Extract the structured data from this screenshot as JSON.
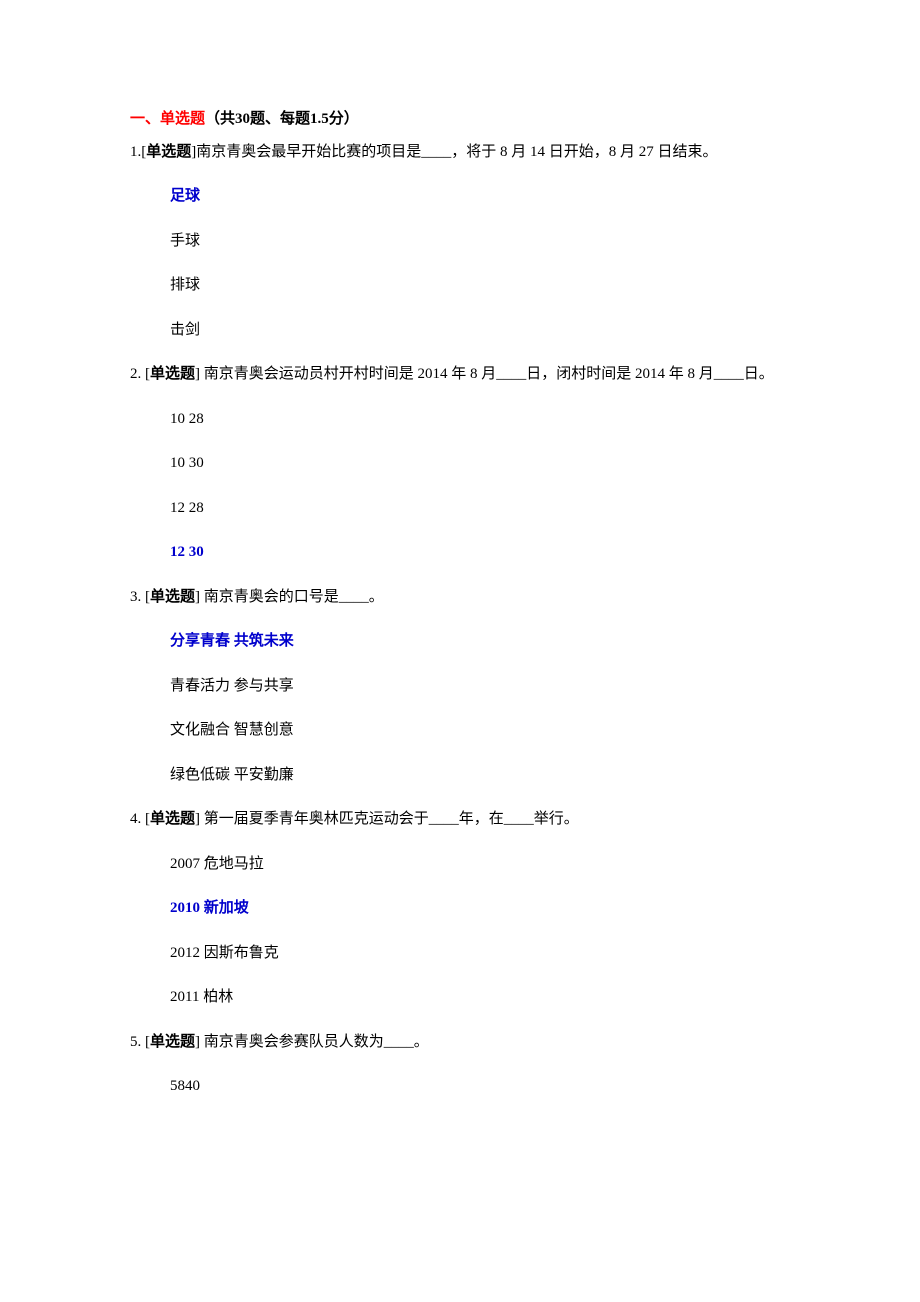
{
  "section": {
    "number": "一、",
    "title": "单选题",
    "count": "（共30题、每题1.5分）"
  },
  "questions": [
    {
      "num": "1.",
      "type_open": "[",
      "type": "单选题",
      "type_close": "]",
      "stem": "南京青奥会最早开始比赛的项目是____，将于 8 月 14 日开始，8 月 27 日结束。",
      "options": [
        "足球",
        "手球",
        "排球",
        "击剑"
      ],
      "correct": 0
    },
    {
      "num": "2.",
      "type_open": " [",
      "type": "单选题",
      "type_close": "] ",
      "stem": "南京青奥会运动员村开村时间是 2014 年 8 月____日，闭村时间是 2014 年 8 月____日。",
      "options": [
        "10 28",
        "10 30",
        "12 28",
        "12 30"
      ],
      "correct": 3
    },
    {
      "num": "3.",
      "type_open": " [",
      "type": "单选题",
      "type_close": "] ",
      "stem": "南京青奥会的口号是____。",
      "options": [
        "分享青春 共筑未来",
        "青春活力 参与共享",
        "文化融合 智慧创意",
        "绿色低碳 平安勤廉"
      ],
      "correct": 0
    },
    {
      "num": "4.",
      "type_open": " [",
      "type": "单选题",
      "type_close": "] ",
      "stem": "第一届夏季青年奥林匹克运动会于____年，在____举行。",
      "options": [
        "2007 危地马拉",
        "2010 新加坡",
        "2012 因斯布鲁克",
        "2011 柏林"
      ],
      "correct": 1
    },
    {
      "num": "5.",
      "type_open": " [",
      "type": "单选题",
      "type_close": "] ",
      "stem": "南京青奥会参赛队员人数为____。",
      "options": [
        "5840"
      ],
      "correct": -1
    }
  ]
}
